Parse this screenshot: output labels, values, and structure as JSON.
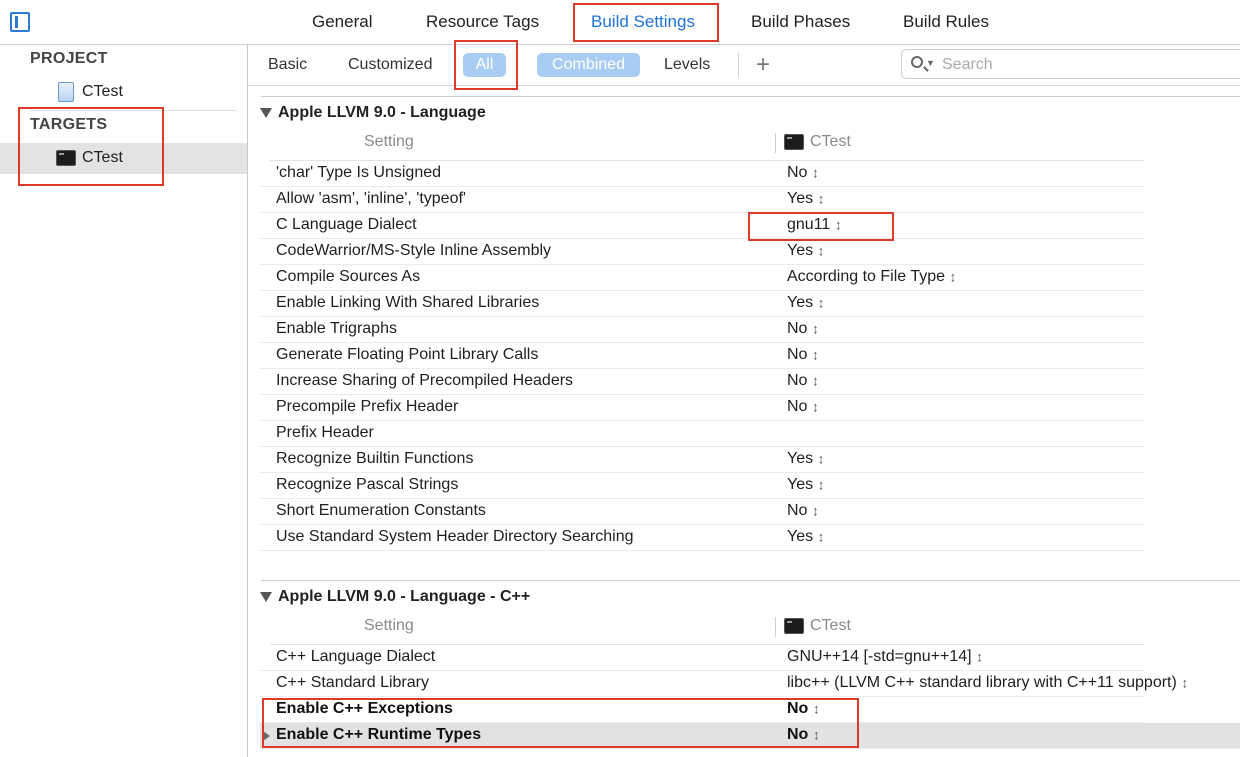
{
  "tabs": {
    "general": "General",
    "resource_tags": "Resource Tags",
    "build_settings": "Build Settings",
    "build_phases": "Build Phases",
    "build_rules": "Build Rules"
  },
  "sidebar": {
    "project_header": "PROJECT",
    "project_item": "CTest",
    "targets_header": "TARGETS",
    "target_item": "CTest"
  },
  "filters": {
    "basic": "Basic",
    "customized": "Customized",
    "all": "All",
    "combined": "Combined",
    "levels": "Levels",
    "add": "+"
  },
  "search": {
    "placeholder": "Search",
    "value": ""
  },
  "sections": [
    {
      "title": "Apple LLVM 9.0 - Language",
      "col_setting": "Setting",
      "col_target": "CTest",
      "rows": [
        {
          "name": "'char' Type Is Unsigned",
          "value": "No"
        },
        {
          "name": "Allow 'asm', 'inline', 'typeof'",
          "value": "Yes"
        },
        {
          "name": "C Language Dialect",
          "value": "gnu11"
        },
        {
          "name": "CodeWarrior/MS-Style Inline Assembly",
          "value": "Yes"
        },
        {
          "name": "Compile Sources As",
          "value": "According to File Type"
        },
        {
          "name": "Enable Linking With Shared Libraries",
          "value": "Yes"
        },
        {
          "name": "Enable Trigraphs",
          "value": "No"
        },
        {
          "name": "Generate Floating Point Library Calls",
          "value": "No"
        },
        {
          "name": "Increase Sharing of Precompiled Headers",
          "value": "No"
        },
        {
          "name": "Precompile Prefix Header",
          "value": "No"
        },
        {
          "name": "Prefix Header",
          "value": ""
        },
        {
          "name": "Recognize Builtin Functions",
          "value": "Yes"
        },
        {
          "name": "Recognize Pascal Strings",
          "value": "Yes"
        },
        {
          "name": "Short Enumeration Constants",
          "value": "No"
        },
        {
          "name": "Use Standard System Header Directory Searching",
          "value": "Yes"
        }
      ]
    },
    {
      "title": "Apple LLVM 9.0 - Language - C++",
      "col_setting": "Setting",
      "col_target": "CTest",
      "rows": [
        {
          "name": "C++ Language Dialect",
          "value": "GNU++14 [-std=gnu++14]"
        },
        {
          "name": "C++ Standard Library",
          "value": "libc++ (LLVM C++ standard library with C++11 support)"
        },
        {
          "name": "Enable C++ Exceptions",
          "value": "No"
        },
        {
          "name": "Enable C++ Runtime Types",
          "value": "No"
        }
      ]
    }
  ],
  "colors": {
    "accent": "#1f73d8",
    "pill": "#a9cdf2",
    "highlight": "#dc3b2a"
  }
}
